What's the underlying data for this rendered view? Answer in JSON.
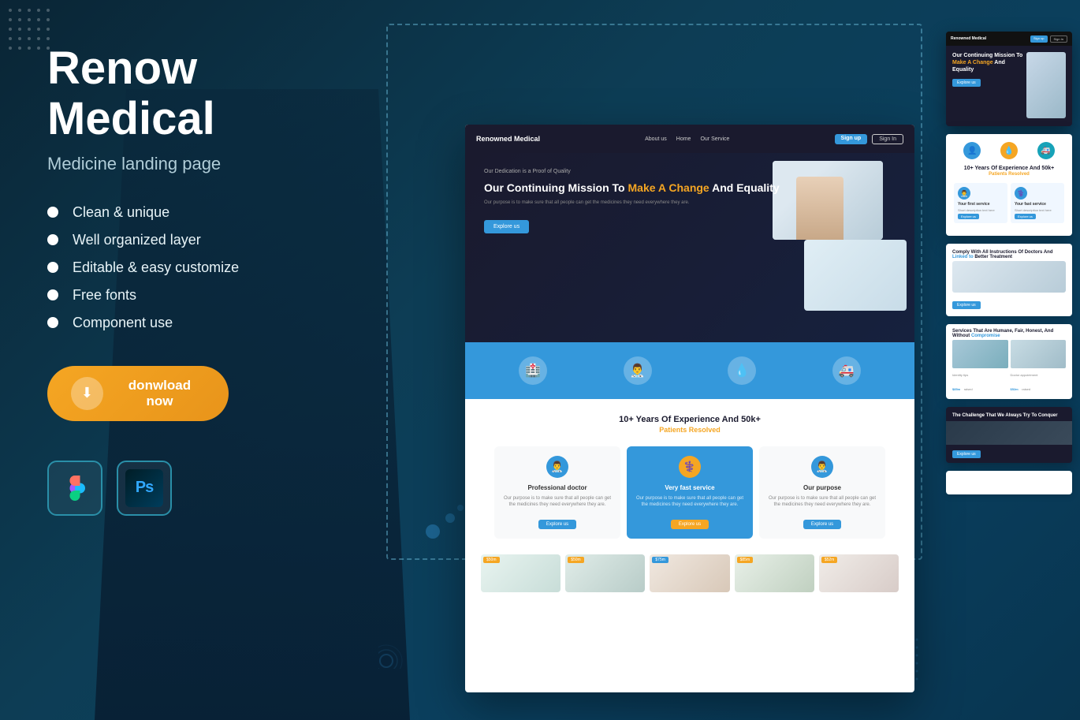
{
  "page": {
    "title": "Renow Medical",
    "subtitle": "Medicine landing page",
    "background_color": "#0d3347"
  },
  "features": [
    {
      "label": "Clean & unique"
    },
    {
      "label": "Well organized layer"
    },
    {
      "label": "Editable & easy customize"
    },
    {
      "label": "Free fonts"
    },
    {
      "label": "Component use"
    }
  ],
  "download_button": {
    "label": "donwload now",
    "icon": "⬇"
  },
  "tools": [
    {
      "name": "Figma",
      "icon": "figma"
    },
    {
      "name": "Photoshop",
      "icon": "Ps"
    }
  ],
  "preview": {
    "brand": "Renowned Medical",
    "nav_links": [
      "About us",
      "Home",
      "Our Service"
    ],
    "nav_btns": [
      "Sign up",
      "Sign In"
    ],
    "hero": {
      "tag": "Our Dedication is a Proof of Quality",
      "title_part1": "Our Continuing Mission To ",
      "title_highlight": "Make A Change",
      "title_part2": " And Equality",
      "description": "Our purpose is to make sure that all people can get the medicines they need everywhere they are.",
      "explore_btn": "Explore us"
    },
    "stats_icons": [
      "🏥",
      "👨‍⚕️",
      "💧",
      "🚑"
    ],
    "experience": {
      "title": "10+ Years Of Experience And 50k+",
      "subtitle": "Patients Resolved"
    },
    "services": [
      {
        "icon": "👨‍⚕️",
        "title": "Professional doctor",
        "desc": "Our purpose is to make sure that all people can get the medicines they need everywhere they are.",
        "btn": "Explore us",
        "highlighted": false
      },
      {
        "icon": "⚕️",
        "title": "Very fast service",
        "desc": "Our purpose is to make sure that all people can get the medicines they need everywhere they are.",
        "btn": "Explore us",
        "highlighted": true
      },
      {
        "icon": "👨‍⚕️",
        "title": "Our purpose",
        "desc": "Our purpose is to make sure that all people can get the medicines they need everywhere they are.",
        "btn": "Explore us",
        "highlighted": false
      }
    ]
  },
  "right_panel": {
    "experience_title": "10+ Years Of Experience And 50k+",
    "experience_subtitle": "Patients Resolved",
    "comply_title_part1": "Comply With All Instructions Of Doctors And ",
    "comply_title_highlight": "Linked to",
    "comply_title_part2": " Better Treatment",
    "services_title_part1": "Services That Are Humane, Fair, Honest, And Without ",
    "services_title_highlight": "Compromise",
    "challenge_title": "The Challenge That We Always Try To Conquer",
    "explore_label": "Explore us",
    "image_labels": [
      "Identity tips",
      "Doctor appointment"
    ],
    "price_tags": [
      "$50m",
      "$50m",
      "$75m",
      "$85m",
      "$52m"
    ]
  },
  "bottom_strip_badges": [
    "$50m",
    "$50m",
    "$75m",
    "$85m",
    "$52m"
  ]
}
